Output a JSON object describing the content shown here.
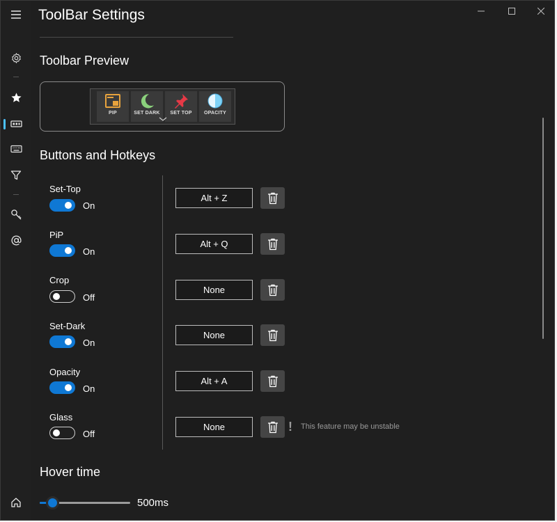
{
  "window": {
    "title": "ToolBar Settings"
  },
  "nav": {
    "items": [
      {
        "icon": "menu-icon"
      },
      {
        "icon": "gear-icon"
      },
      {
        "icon": "star-icon"
      },
      {
        "icon": "toolbar-icon",
        "active": true
      },
      {
        "icon": "keyboard-icon"
      },
      {
        "icon": "filter-icon"
      },
      {
        "icon": "key-icon"
      },
      {
        "icon": "at-icon"
      },
      {
        "icon": "home-icon"
      }
    ]
  },
  "preview": {
    "title": "Toolbar Preview",
    "buttons": [
      {
        "label": "PIP",
        "icon": "pip-icon",
        "color": "#e8a33d"
      },
      {
        "label": "SET DARK",
        "icon": "moon-icon",
        "color": "#8bd17c"
      },
      {
        "label": "SET TOP",
        "icon": "pin-icon",
        "color": "#e63946"
      },
      {
        "label": "OPACITY",
        "icon": "opacity-icon",
        "color": "#7fd3f7"
      }
    ]
  },
  "buttons_section": {
    "title": "Buttons and Hotkeys",
    "rows": [
      {
        "name": "Set-Top",
        "enabled": true,
        "state_label": "On",
        "hotkey": "Alt + Z"
      },
      {
        "name": "PiP",
        "enabled": true,
        "state_label": "On",
        "hotkey": "Alt + Q"
      },
      {
        "name": "Crop",
        "enabled": false,
        "state_label": "Off",
        "hotkey": "None"
      },
      {
        "name": "Set-Dark",
        "enabled": true,
        "state_label": "On",
        "hotkey": "None"
      },
      {
        "name": "Opacity",
        "enabled": true,
        "state_label": "On",
        "hotkey": "Alt + A"
      },
      {
        "name": "Glass",
        "enabled": false,
        "state_label": "Off",
        "hotkey": "None"
      }
    ],
    "warning": {
      "icon": "!",
      "text": "This feature may be unstable"
    }
  },
  "hover": {
    "title": "Hover time",
    "value_label": "500ms",
    "slider_fraction": 0.14
  },
  "colors": {
    "accent": "#0f78d4",
    "background": "#1f1f1f"
  }
}
